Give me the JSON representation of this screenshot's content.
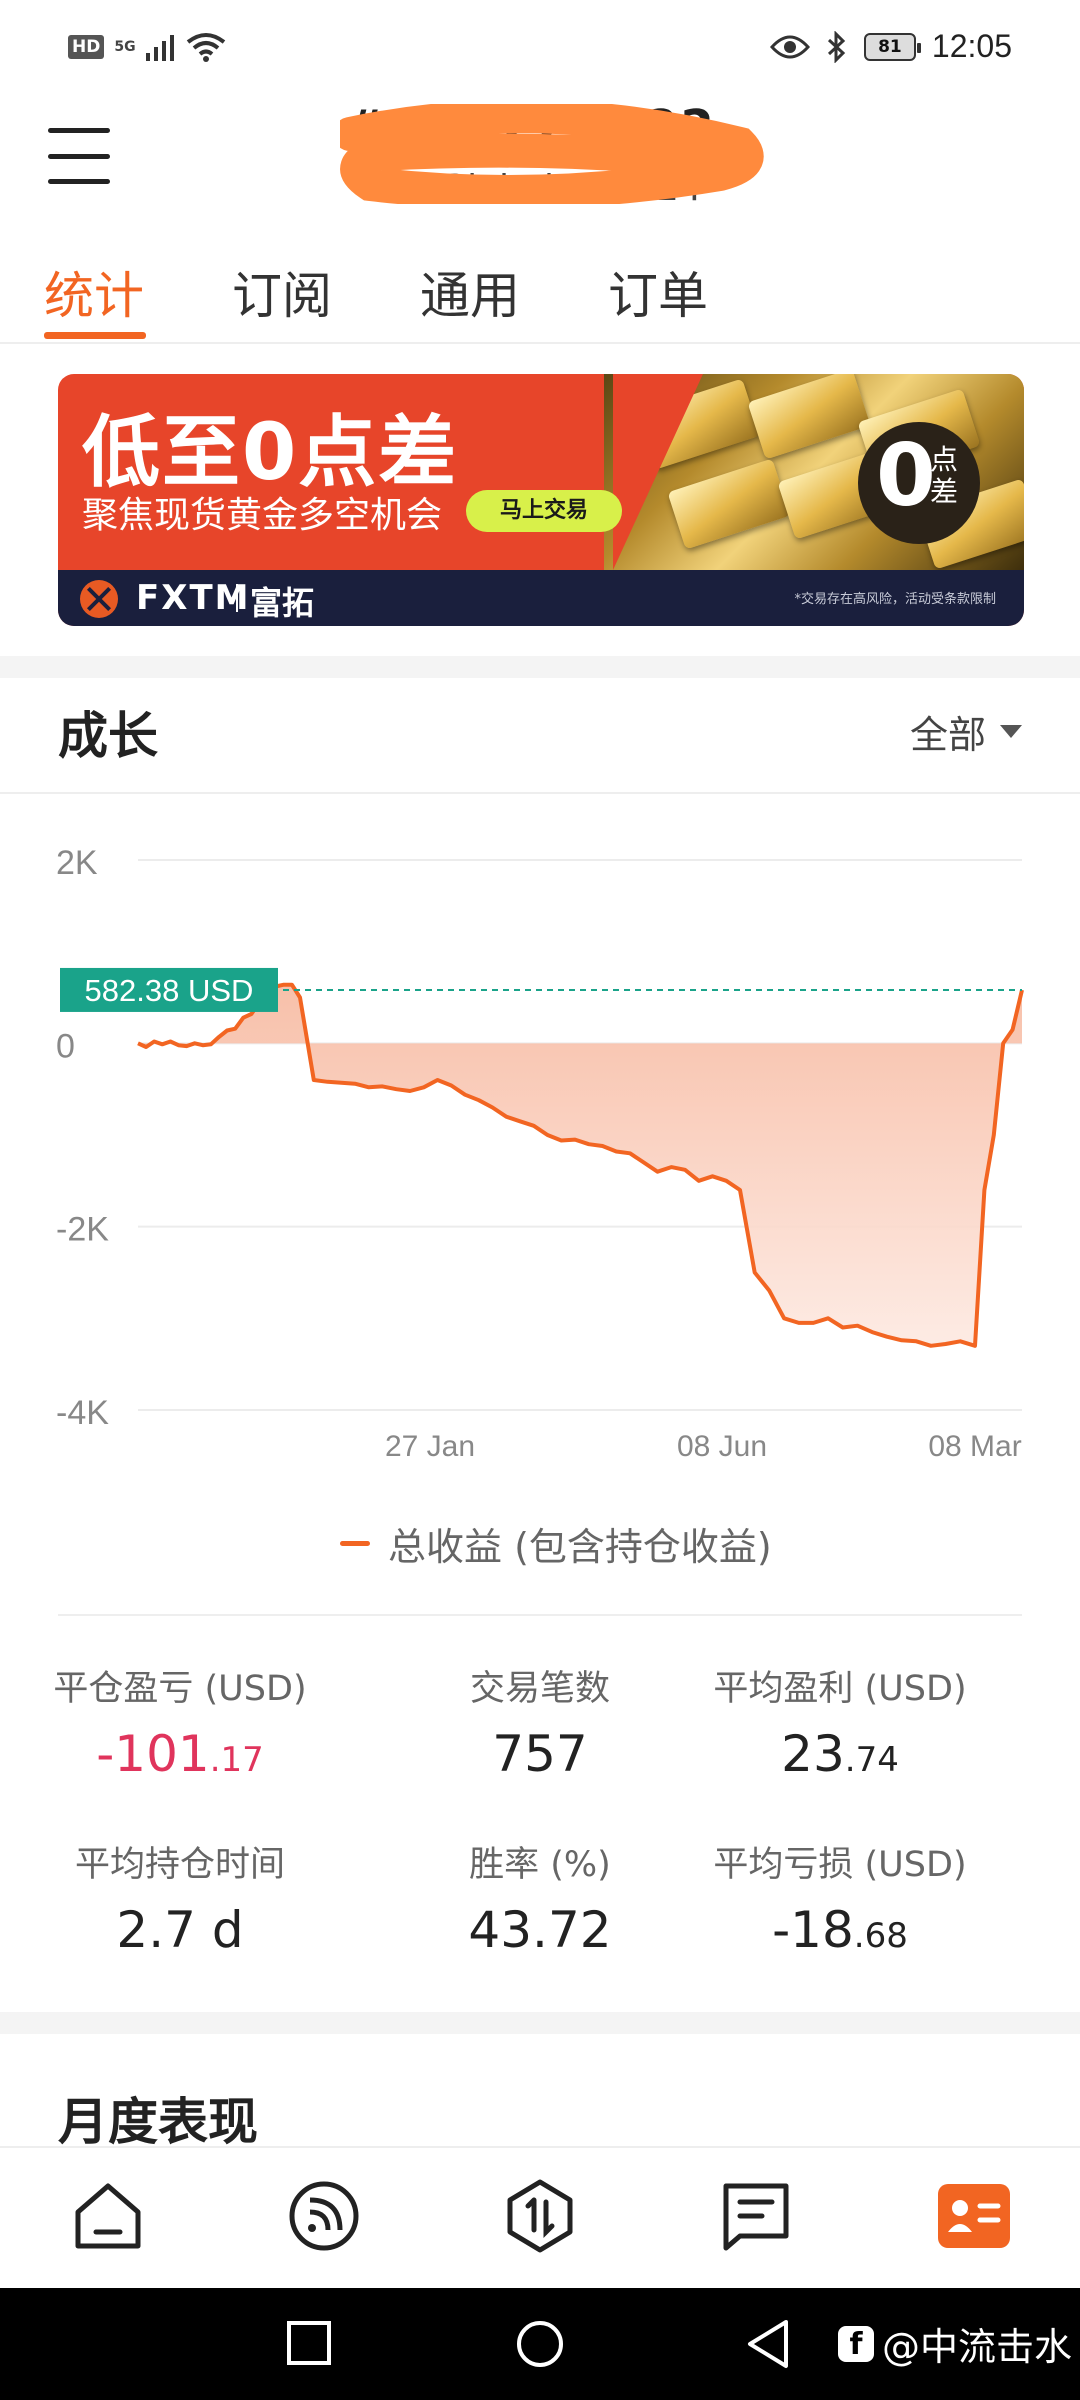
{
  "status_bar": {
    "network_hd": "HD",
    "network_5g": "5G",
    "battery": "81",
    "time": "12:05"
  },
  "header": {
    "account_title": "#2··2222··22",
    "account_subtitle": "XM.Global-Real 24"
  },
  "tabs": [
    {
      "label": "统计",
      "active": true
    },
    {
      "label": "订阅",
      "active": false
    },
    {
      "label": "通用",
      "active": false
    },
    {
      "label": "订单",
      "active": false
    }
  ],
  "banner": {
    "headline": "低至0点差",
    "subline": "聚焦现货黄金多空机会",
    "cta": "马上交易",
    "badge_number": "0",
    "badge_text": "点差",
    "brand": "FXTM",
    "brand_cn": "富拓",
    "disclaimer": "*交易存在高风险，活动受条款限制",
    "colors": {
      "primary": "#e7452a",
      "footer": "#1a1f3d",
      "cta": "#d8f04a"
    }
  },
  "growth": {
    "title": "成长",
    "filter": "全部"
  },
  "chart_data": {
    "type": "area",
    "y_ticks": [
      "2K",
      "0",
      "-2K",
      "-4K"
    ],
    "ylim": [
      -4000,
      2000
    ],
    "x_ticks": [
      "27 Jan",
      "08 Jun",
      "08 Mar"
    ],
    "current_value_label": "582.38 USD",
    "current_value": 582.38,
    "series": [
      {
        "name": "总收益 (包含持仓收益)",
        "color": "#f26522",
        "values": [
          0,
          -40,
          20,
          -10,
          20,
          -20,
          -30,
          0,
          -20,
          -10,
          70,
          140,
          160,
          280,
          320,
          450,
          520,
          620,
          640,
          640,
          500,
          -400,
          -420,
          -430,
          -440,
          -480,
          -470,
          -500,
          -520,
          -480,
          -400,
          -460,
          -560,
          -620,
          -700,
          -800,
          -850,
          -900,
          -1000,
          -1060,
          -1050,
          -1100,
          -1120,
          -1180,
          -1200,
          -1300,
          -1400,
          -1350,
          -1380,
          -1500,
          -1450,
          -1500,
          -1600,
          -2500,
          -2700,
          -3000,
          -3050,
          -3050,
          -3000,
          -3100,
          -3080,
          -3150,
          -3200,
          -3240,
          -3250,
          -3300,
          -3280,
          -3250,
          -3300,
          -1600,
          -1000,
          0,
          150,
          582
        ]
      }
    ],
    "legend": "总收益 (包含持仓收益)"
  },
  "stats": [
    {
      "label": "平仓盈亏 (USD)",
      "int": "-101",
      "dec": ".17",
      "negative": true
    },
    {
      "label": "交易笔数",
      "int": "757",
      "dec": "",
      "negative": false
    },
    {
      "label": "平均盈利 (USD)",
      "int": "23",
      "dec": ".74",
      "negative": false
    },
    {
      "label": "平均持仓时间",
      "int": "2.7 d",
      "dec": "",
      "negative": false
    },
    {
      "label": "胜率 (%)",
      "int": "43.72",
      "dec": "",
      "negative": false
    },
    {
      "label": "平均亏损 (USD)",
      "int": "-18",
      "dec": ".68",
      "negative": false
    }
  ],
  "monthly": {
    "title": "月度表现"
  },
  "bottom_nav": [
    {
      "icon": "home-icon",
      "active": false
    },
    {
      "icon": "feed-icon",
      "active": false
    },
    {
      "icon": "trade-icon",
      "active": false
    },
    {
      "icon": "message-icon",
      "active": false
    },
    {
      "icon": "profile-card-icon",
      "active": true
    }
  ],
  "watermark": {
    "text": "@中流击水"
  },
  "accent_color": "#f26522"
}
